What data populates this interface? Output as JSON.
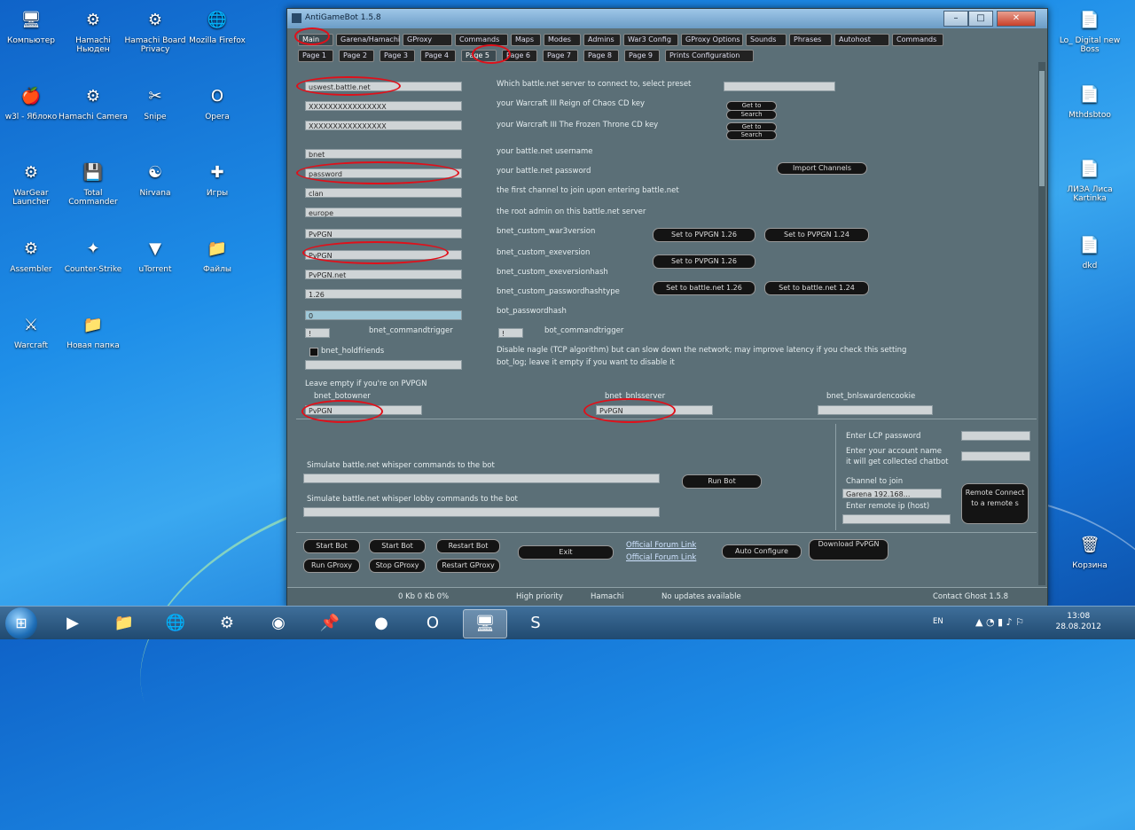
{
  "desktop": {
    "icons": [
      {
        "label": "Компьютер",
        "glyph": "🖥"
      },
      {
        "label": "Hamachi Ньюден",
        "glyph": "⚙"
      },
      {
        "label": "Hamachi Board Privacy",
        "glyph": "⚙"
      },
      {
        "label": "Mozilla Firefox",
        "glyph": "🌐"
      },
      {
        "label": "w3l - Яблоко",
        "glyph": "🍎"
      },
      {
        "label": "Hamachi Camera",
        "glyph": "⚙"
      },
      {
        "label": "Snipe",
        "glyph": "✂"
      },
      {
        "label": "Opera",
        "glyph": "O"
      },
      {
        "label": "WarGear Launcher",
        "glyph": "⚙"
      },
      {
        "label": "Total Commander",
        "glyph": "💾"
      },
      {
        "label": "Nirvana",
        "glyph": "☯"
      },
      {
        "label": "Игры",
        "glyph": "✚"
      },
      {
        "label": "Assembler",
        "glyph": "⚙"
      },
      {
        "label": "Counter-Strike",
        "glyph": "✦"
      },
      {
        "label": "uTorrent",
        "glyph": "▼"
      },
      {
        "label": "Файлы",
        "glyph": "📁"
      },
      {
        "label": "Warcraft",
        "glyph": "⚔"
      },
      {
        "label": "Новая папка",
        "glyph": "📁"
      }
    ],
    "right_icons": [
      {
        "label": "Lo_ Digital new Boss",
        "glyph": "📄"
      },
      {
        "label": "Mthdsbtoo",
        "glyph": "📄"
      },
      {
        "label": "ЛИЗА Лиса Kartinka",
        "glyph": "📄"
      },
      {
        "label": "dkd",
        "glyph": "📄"
      },
      {
        "label": "Корзина",
        "glyph": "🗑"
      }
    ]
  },
  "window": {
    "title": "AntiGameBot 1.5.8",
    "tabs": [
      "Main",
      "Garena/Hamachi",
      "GProxy",
      "Commands",
      "Maps",
      "Modes",
      "Admins",
      "War3 Config",
      "GProxy Options",
      "Sounds",
      "Phrases",
      "Autohost",
      "Commands"
    ],
    "subtabs": [
      "Page 1",
      "Page 2",
      "Page 3",
      "Page 4",
      "Page 5",
      "Page 6",
      "Page 7",
      "Page 8",
      "Page 9",
      "Prints Configuration"
    ],
    "left_fields": [
      "uswest.battle.net",
      "XXXXXXXXXXXXXXXX",
      "XXXXXXXXXXXXXXXX",
      "bnet",
      "password",
      "clan",
      "europe",
      "PvPGN",
      "PvPGN",
      "PvPGN.net",
      "1.26",
      "0"
    ],
    "right_labels": [
      "Which battle.net server to connect to, select preset",
      "your Warcraft III Reign of Chaos CD key",
      "your Warcraft III The Frozen Throne CD key",
      "your battle.net username",
      "your battle.net password",
      "the first channel to join upon entering battle.net",
      "the root admin on this battle.net server",
      "bnet_custom_war3version",
      "bnet_custom_exeversion",
      "bnet_custom_exeversionhash",
      "bnet_custom_passwordhashtype",
      "bot_passwordhash"
    ],
    "cd_buttons": [
      "Get to",
      "Search",
      "Get to",
      "Search"
    ],
    "import_button": "Import Channels",
    "version_pills": [
      "Set to PVPGN 1.26",
      "Set to PVPGN 1.24",
      "Set to PVPGN 1.26",
      "Set to battle.net 1.26",
      "Set to battle.net 1.24"
    ],
    "commandtrigger_label": "bnet_commandtrigger",
    "commandtrigger_label2": "bot_commandtrigger",
    "latency_text": "Disable nagle (TCP algorithm) but can slow down the network; may improve latency if you check this setting",
    "latency_text2": "bot_log; leave it empty if you want to disable it",
    "holdfriends_label": "bnet_holdfriends",
    "pvpgn_note": "Leave empty if you're on PVPGN",
    "bottom_labels": [
      "bnet_botowner",
      "bnet_bnlsserver",
      "bnet_bnlswardencookie"
    ],
    "bottom_values": [
      "PvPGN",
      "PvPGN",
      ""
    ],
    "console": {
      "label1": "Simulate battle.net whisper commands to the bot",
      "label2": "Simulate battle.net whisper lobby commands to the bot",
      "run_button": "Run Bot",
      "lcp_label": "Enter LCP password",
      "account_label": "Enter your account name",
      "account_label2": "it will get collected chatbot",
      "channel_label": "Channel to join",
      "channel_value": "Garena 192.168...",
      "remote_label": "Enter remote ip (host)",
      "remote_button": "Remote Connect to a remote s"
    },
    "footer_buttons": [
      "Start Bot",
      "Start Bot",
      "Restart Bot",
      "Run GProxy",
      "Stop GProxy",
      "Restart GProxy",
      "Exit"
    ],
    "footer_links": [
      "Official Forum Link",
      "Official Forum Link"
    ],
    "footer_buttons2": [
      "Auto Configure",
      "Download PvPGN"
    ],
    "status": [
      "0 Kb 0 Kb 0%",
      "High priority",
      "Hamachi",
      "No updates available",
      "Contact Ghost 1.5.8"
    ]
  },
  "taskbar": {
    "lang": "EN",
    "time": "13:08",
    "date": "28.08.2012"
  }
}
